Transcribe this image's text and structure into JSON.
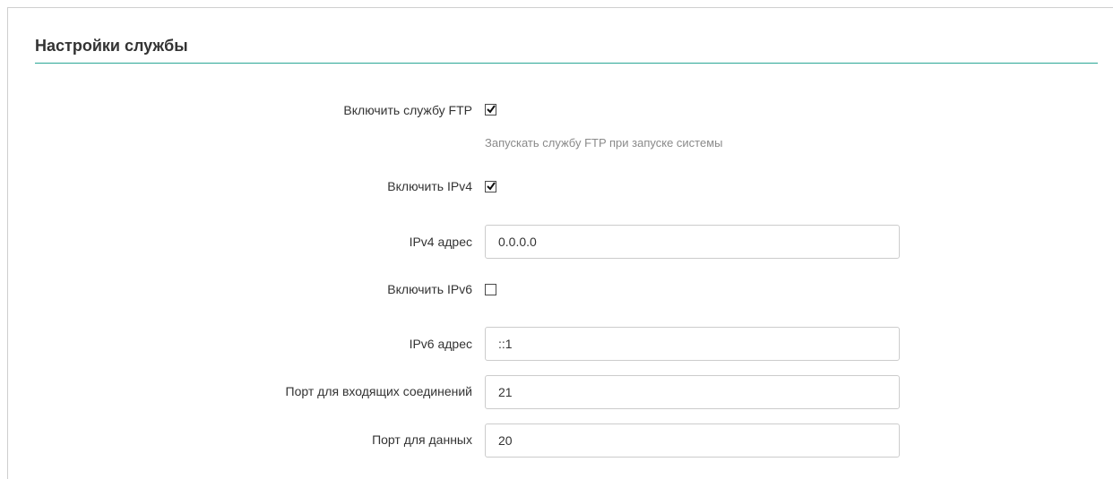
{
  "section": {
    "title": "Настройки службы"
  },
  "accent_color": "#2aa795",
  "fields": {
    "enable_ftp": {
      "label": "Включить службу FTP",
      "checked": true,
      "hint": "Запускать службу FTP при запуске системы"
    },
    "enable_ipv4": {
      "label": "Включить IPv4",
      "checked": true
    },
    "ipv4_address": {
      "label": "IPv4 адрес",
      "value": "0.0.0.0"
    },
    "enable_ipv6": {
      "label": "Включить IPv6",
      "checked": false
    },
    "ipv6_address": {
      "label": "IPv6 адрес",
      "value": "::1"
    },
    "incoming_port": {
      "label": "Порт для входящих соединений",
      "value": "21"
    },
    "data_port": {
      "label": "Порт для данных",
      "value": "20"
    }
  }
}
